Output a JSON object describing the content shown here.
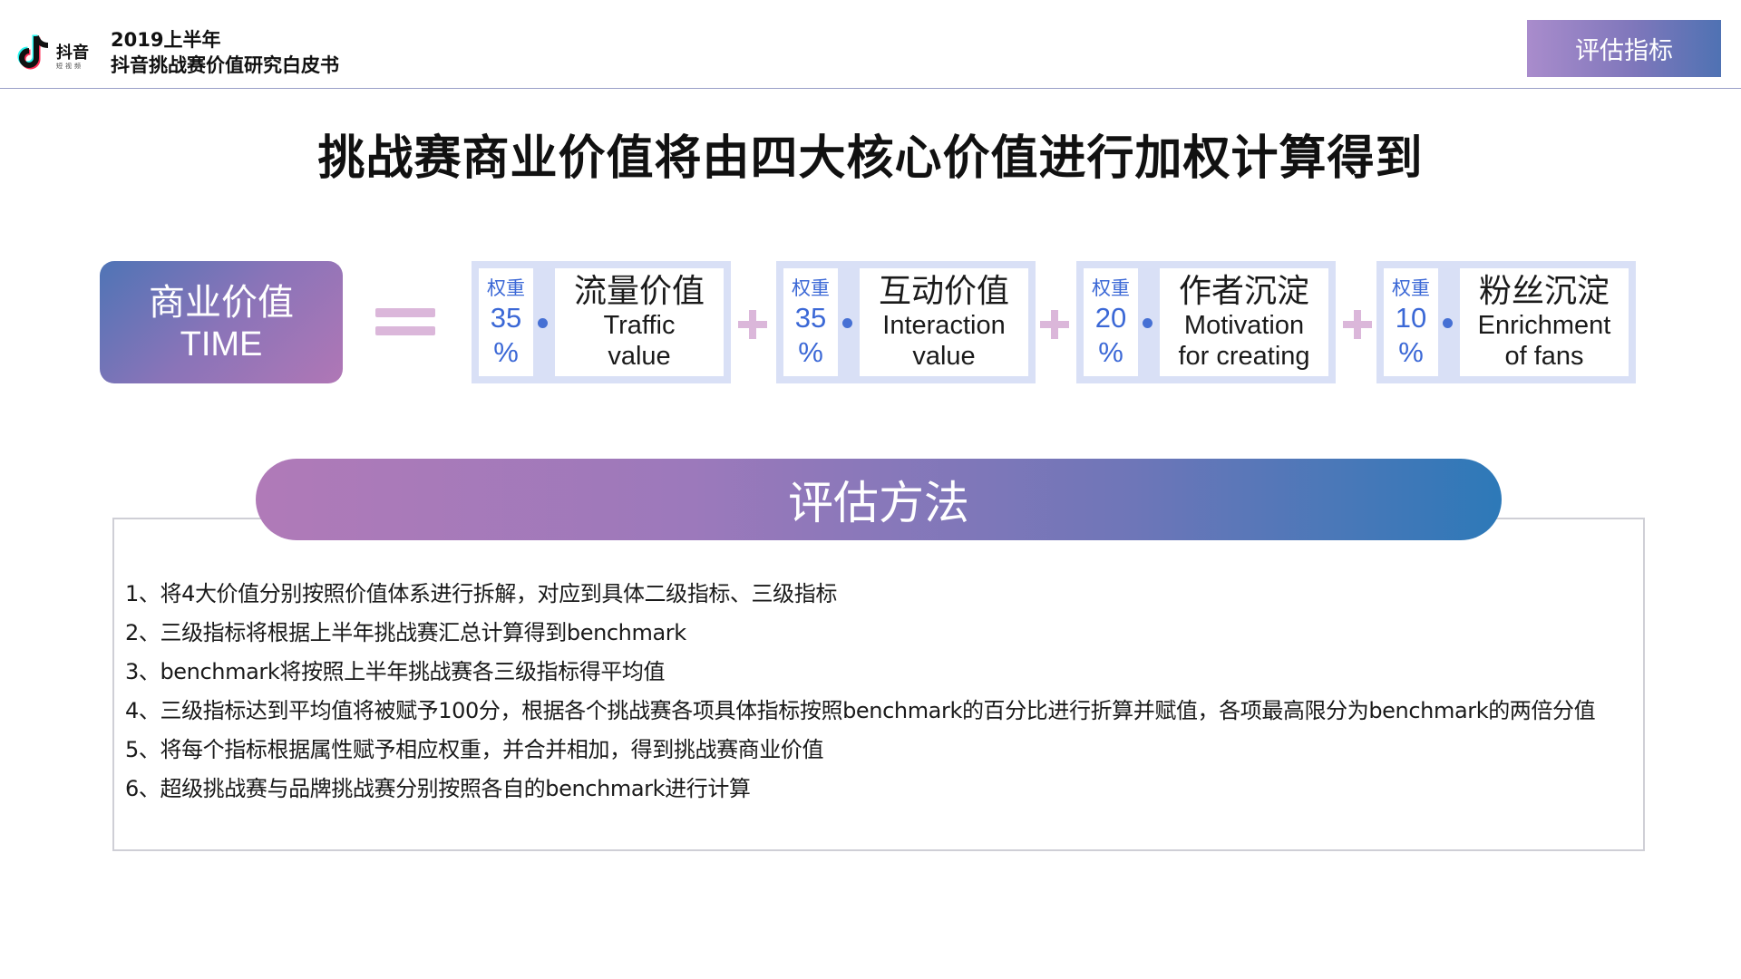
{
  "header": {
    "logo_text": "抖音",
    "logo_sub": "短视频",
    "doc_title_line1": "2019上半年",
    "doc_title_line2": "抖音挑战赛价值研究白皮书",
    "tag_button": "评估指标"
  },
  "main_title": "挑战赛商业价值将由四大核心价值进行加权计算得到",
  "formula": {
    "left_box": {
      "cn": "商业价值",
      "en": "TIME"
    },
    "components": [
      {
        "weight_label": "权重",
        "weight_value": "35",
        "percent": "%",
        "title_cn": "流量价值",
        "title_en_line1": "Traffic",
        "title_en_line2": "value"
      },
      {
        "weight_label": "权重",
        "weight_value": "35",
        "percent": "%",
        "title_cn": "互动价值",
        "title_en_line1": "Interaction",
        "title_en_line2": "value"
      },
      {
        "weight_label": "权重",
        "weight_value": "20",
        "percent": "%",
        "title_cn": "作者沉淀",
        "title_en_line1": "Motivation",
        "title_en_line2": "for creating"
      },
      {
        "weight_label": "权重",
        "weight_value": "10",
        "percent": "%",
        "title_cn": "粉丝沉淀",
        "title_en_line1": "Enrichment",
        "title_en_line2": "of fans"
      }
    ]
  },
  "method": {
    "heading": "评估方法",
    "items": [
      "1、将4大价值分别按照价值体系进行拆解，对应到具体二级指标、三级指标",
      "2、三级指标将根据上半年挑战赛汇总计算得到benchmark",
      "3、benchmark将按照上半年挑战赛各三级指标得平均值",
      "4、三级指标达到平均值将被赋予100分，根据各个挑战赛各项具体指标按照benchmark的百分比进行折算并赋值，各项最高限分为benchmark的两倍分值",
      "5、将每个指标根据属性赋予相应权重，并合并相加，得到挑战赛商业价值",
      "6、超级挑战赛与品牌挑战赛分别按照各自的benchmark进行计算"
    ]
  },
  "colors": {
    "accent_purple": "#b077b6",
    "accent_blue": "#2d79b8",
    "weight_blue": "#3b68d6",
    "card_border": "#d9e0f6",
    "plus_pink": "#dbb7da"
  },
  "icons": {
    "logo": "tiktok-note-icon"
  }
}
